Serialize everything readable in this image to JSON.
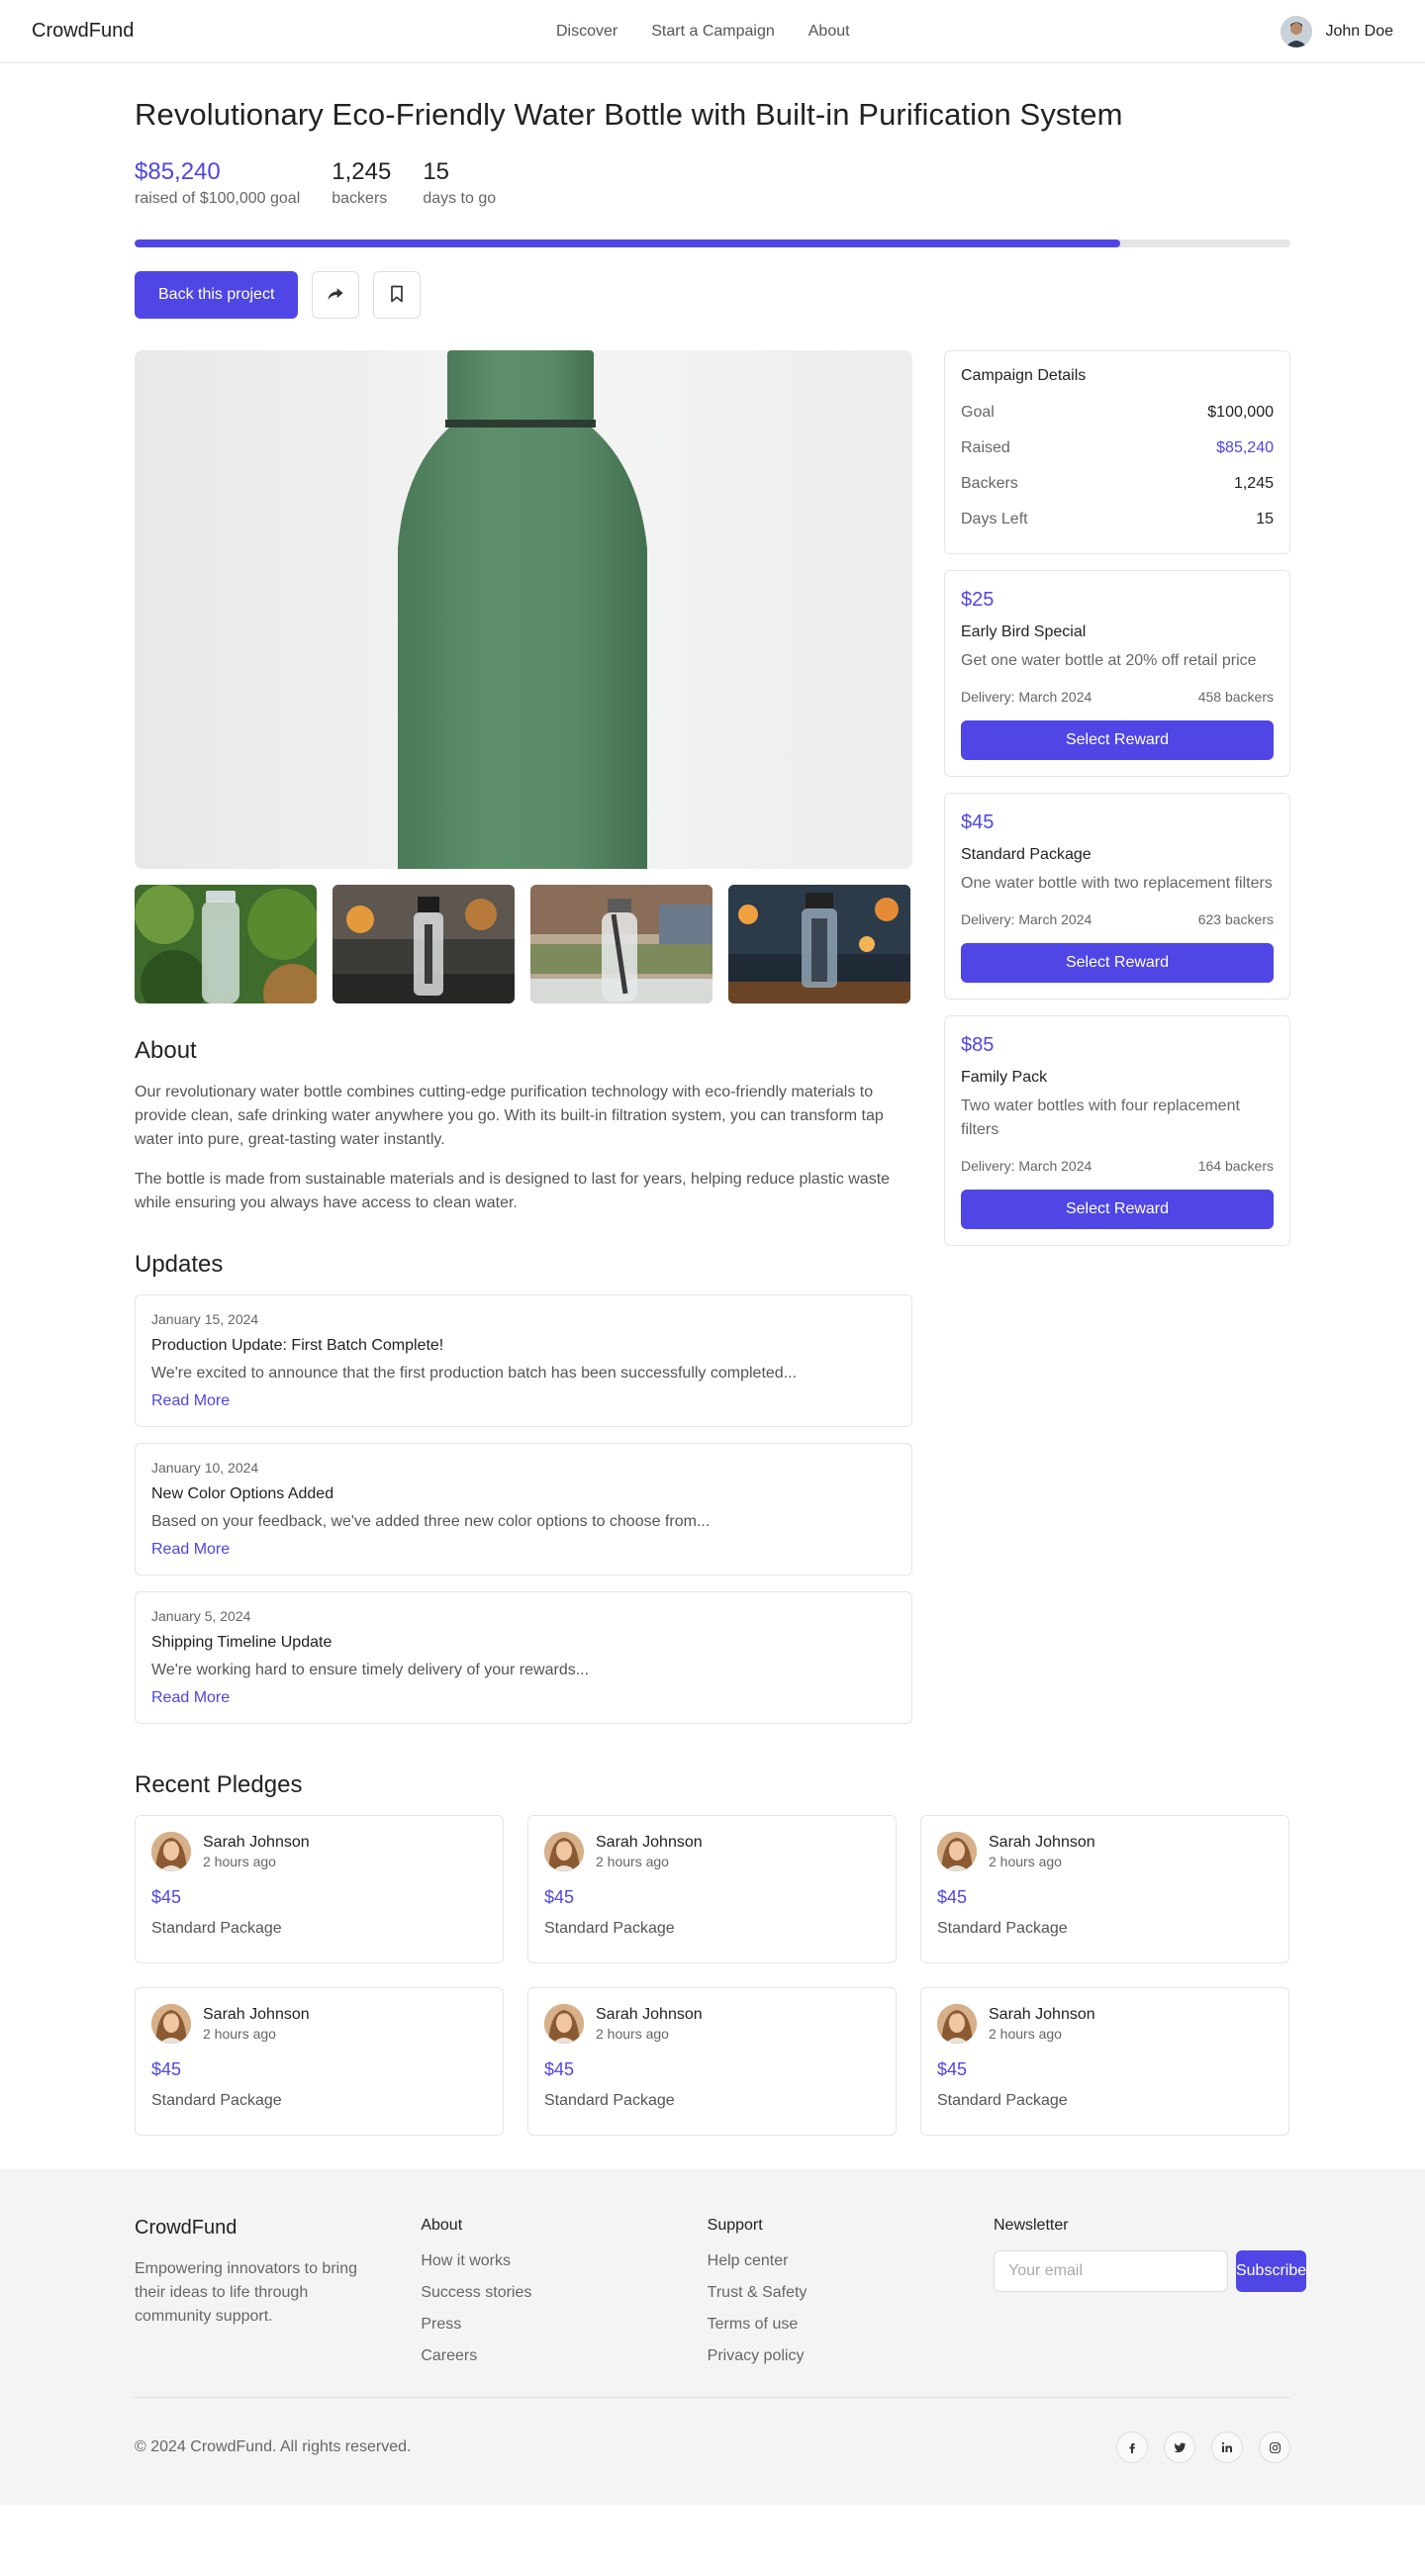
{
  "header": {
    "brand": "CrowdFund",
    "nav": [
      "Discover",
      "Start a Campaign",
      "About"
    ],
    "user_name": "John Doe"
  },
  "campaign": {
    "title": "Revolutionary Eco-Friendly Water Bottle with Built-in Purification System",
    "raised": "$85,240",
    "raised_label": "raised of $100,000 goal",
    "backers": "1,245",
    "backers_label": "backers",
    "days": "15",
    "days_label": "days to go",
    "progress_fraction": 0.8524,
    "back_label": "Back this project"
  },
  "details": {
    "heading": "Campaign Details",
    "rows": [
      {
        "k": "Goal",
        "v": "$100,000"
      },
      {
        "k": "Raised",
        "v": "$85,240"
      },
      {
        "k": "Backers",
        "v": "1,245"
      },
      {
        "k": "Days Left",
        "v": "15"
      }
    ]
  },
  "rewards": [
    {
      "price": "$25",
      "name": "Early Bird Special",
      "desc": "Get one water bottle at 20% off retail price",
      "delivery": "Delivery: March 2024",
      "backers": "458 backers",
      "button": "Select Reward"
    },
    {
      "price": "$45",
      "name": "Standard Package",
      "desc": "One water bottle with two replacement filters",
      "delivery": "Delivery: March 2024",
      "backers": "623 backers",
      "button": "Select Reward"
    },
    {
      "price": "$85",
      "name": "Family Pack",
      "desc": "Two water bottles with four replacement filters",
      "delivery": "Delivery: March 2024",
      "backers": "164 backers",
      "button": "Select Reward"
    }
  ],
  "about": {
    "heading": "About",
    "p1": "Our revolutionary water bottle combines cutting-edge purification technology with eco-friendly materials to provide clean, safe drinking water anywhere you go. With its built-in filtration system, you can transform tap water into pure, great-tasting water instantly.",
    "p2": "The bottle is made from sustainable materials and is designed to last for years, helping reduce plastic waste while ensuring you always have access to clean water."
  },
  "updates": {
    "heading": "Updates",
    "items": [
      {
        "date": "January 15, 2024",
        "title": "Production Update: First Batch Complete!",
        "excerpt": "We're excited to announce that the first production batch has been successfully completed...",
        "more": "Read More"
      },
      {
        "date": "January 10, 2024",
        "title": "New Color Options Added",
        "excerpt": "Based on your feedback, we've added three new color options to choose from...",
        "more": "Read More"
      },
      {
        "date": "January 5, 2024",
        "title": "Shipping Timeline Update",
        "excerpt": "We're working hard to ensure timely delivery of your rewards...",
        "more": "Read More"
      }
    ]
  },
  "pledges": {
    "heading": "Recent Pledges",
    "items": [
      {
        "name": "Sarah Johnson",
        "time": "2 hours ago",
        "amount": "$45",
        "tier": "Standard Package"
      },
      {
        "name": "Sarah Johnson",
        "time": "2 hours ago",
        "amount": "$45",
        "tier": "Standard Package"
      },
      {
        "name": "Sarah Johnson",
        "time": "2 hours ago",
        "amount": "$45",
        "tier": "Standard Package"
      },
      {
        "name": "Sarah Johnson",
        "time": "2 hours ago",
        "amount": "$45",
        "tier": "Standard Package"
      },
      {
        "name": "Sarah Johnson",
        "time": "2 hours ago",
        "amount": "$45",
        "tier": "Standard Package"
      },
      {
        "name": "Sarah Johnson",
        "time": "2 hours ago",
        "amount": "$45",
        "tier": "Standard Package"
      }
    ]
  },
  "footer": {
    "brand": "CrowdFund",
    "tagline": "Empowering innovators to bring their ideas to life through community support.",
    "about_heading": "About",
    "about_links": [
      "How it works",
      "Success stories",
      "Press",
      "Careers"
    ],
    "support_heading": "Support",
    "support_links": [
      "Help center",
      "Trust & Safety",
      "Terms of use",
      "Privacy policy"
    ],
    "newsletter_heading": "Newsletter",
    "email_placeholder": "Your email",
    "subscribe": "Subscribe",
    "copyright": "© 2024 CrowdFund. All rights reserved.",
    "socials": [
      "facebook-icon",
      "twitter-icon",
      "linkedin-icon",
      "instagram-icon"
    ]
  },
  "colors": {
    "accent": "#4f46e5",
    "bottle": "#5b8a68"
  }
}
